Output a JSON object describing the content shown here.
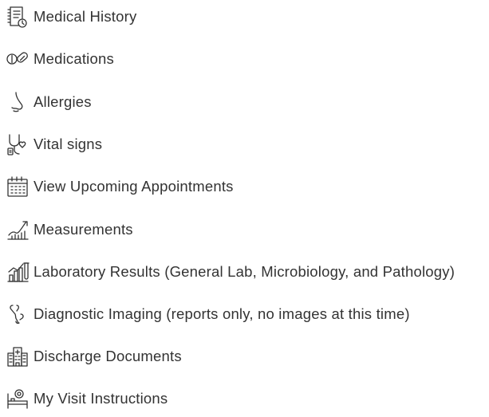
{
  "items": [
    {
      "label": "Medical History",
      "icon": "medical-history-icon"
    },
    {
      "label": "Medications",
      "icon": "pills-icon"
    },
    {
      "label": "Allergies",
      "icon": "nose-icon"
    },
    {
      "label": "Vital signs",
      "icon": "stethoscope-icon"
    },
    {
      "label": "View Upcoming Appointments",
      "icon": "calendar-icon"
    },
    {
      "label": "Measurements",
      "icon": "growth-chart-icon"
    },
    {
      "label": "Laboratory Results (General Lab, Microbiology, and Pathology)",
      "icon": "lab-chart-icon"
    },
    {
      "label": "Diagnostic Imaging (reports only, no images at this time)",
      "icon": "bone-icon"
    },
    {
      "label": "Discharge Documents",
      "icon": "hospital-building-icon"
    },
    {
      "label": "My Visit Instructions",
      "icon": "hospital-bed-icon"
    }
  ],
  "colors": {
    "text": "#333333",
    "background": "#ffffff"
  }
}
